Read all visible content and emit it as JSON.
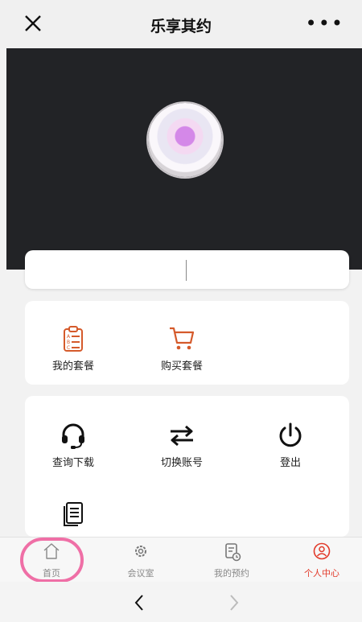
{
  "header": {
    "title": "乐享其约",
    "more": "•••"
  },
  "card_packages": {
    "items": [
      {
        "label": "我的套餐",
        "icon": "clipboard-list-icon"
      },
      {
        "label": "购买套餐",
        "icon": "shopping-cart-icon"
      }
    ]
  },
  "card_actions": {
    "items": [
      {
        "label": "查询下载",
        "icon": "headset-icon"
      },
      {
        "label": "切换账号",
        "icon": "swap-arrows-icon"
      },
      {
        "label": "登出",
        "icon": "power-icon"
      },
      {
        "label": "",
        "icon": "document-list-icon"
      }
    ]
  },
  "bottom_nav": {
    "items": [
      {
        "label": "首页",
        "icon": "home-icon"
      },
      {
        "label": "会议室",
        "icon": "settings-gear-icon"
      },
      {
        "label": "我的预约",
        "icon": "calendar-doc-icon"
      },
      {
        "label": "个人中心",
        "icon": "user-circle-icon"
      }
    ]
  },
  "colors": {
    "accent": "#e23a2a",
    "hero_bg": "#222326",
    "highlight": "#ef6fa6"
  }
}
